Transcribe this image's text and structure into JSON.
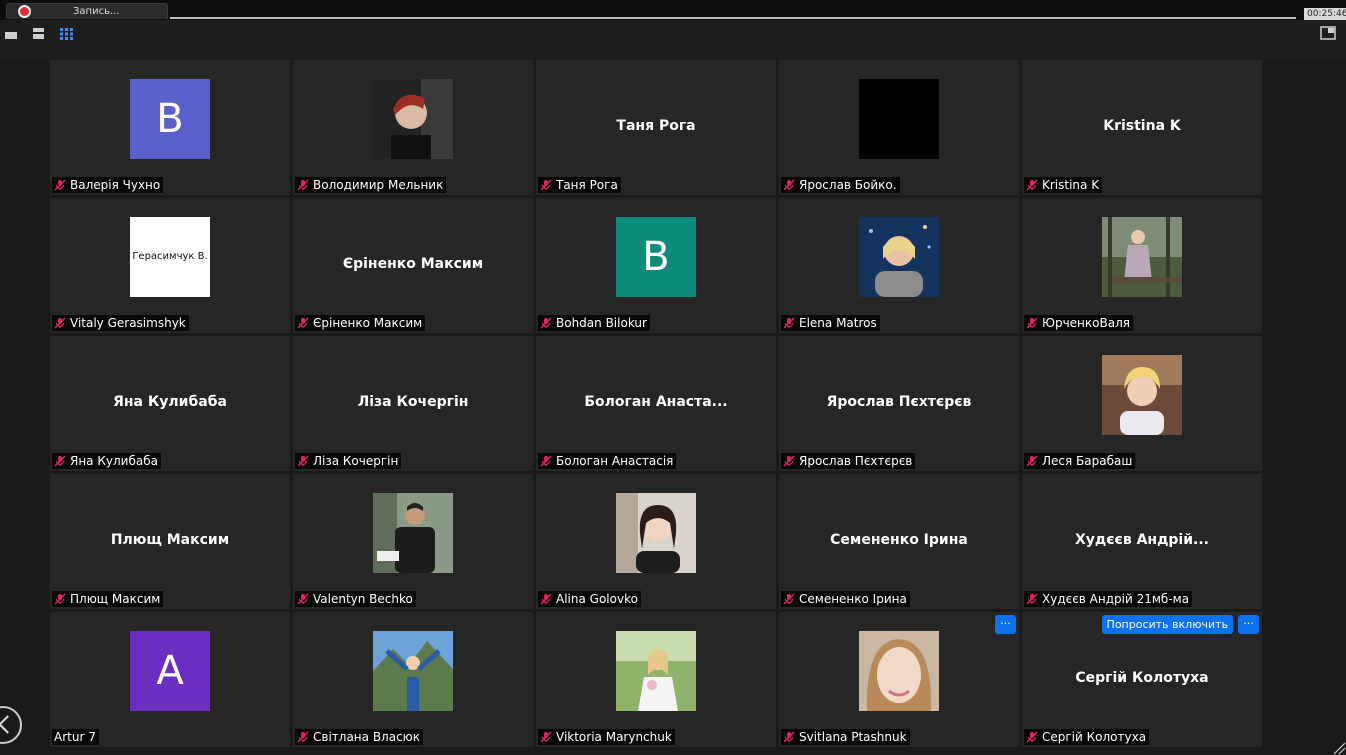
{
  "app": {
    "recording_label": "Запись...",
    "timer": "00:25:46",
    "accent_color": "#0e72ed"
  },
  "participants": [
    {
      "display_name": "Валерія Чухно",
      "avatar_letter": "B",
      "avatar_color": "#5a5fc9"
    },
    {
      "display_name": "Володимир Мельник",
      "photo": "photo-portrait-dark"
    },
    {
      "display_name": "Таня Рога",
      "center_name": "Таня Рога"
    },
    {
      "display_name": "Ярослав Бойко.",
      "photo": "black-video"
    },
    {
      "display_name": "Kristina K",
      "center_name": "Kristina K"
    },
    {
      "display_name": "Vitaly Gerasimshyk",
      "card_text": "Герасимчук В."
    },
    {
      "display_name": "Єріненко Максим",
      "center_name": "Єріненко Максим"
    },
    {
      "display_name": "Bohdan Bilokur",
      "avatar_letter": "B",
      "avatar_color": "#0c8a7a"
    },
    {
      "display_name": "Elena Matros",
      "photo": "photo-portrait-night"
    },
    {
      "display_name": "ЮрченкоВаля",
      "photo": "photo-portrait-forest"
    },
    {
      "display_name": "Яна Кулибаба",
      "center_name": "Яна Кулибаба"
    },
    {
      "display_name": "Ліза Кочергін",
      "center_name": "Ліза Кочергін"
    },
    {
      "display_name": "Бологан Анастасія",
      "center_name": "Бологан  Анаста..."
    },
    {
      "display_name": "Ярослав Пєхтєрєв",
      "center_name": "Ярослав Пєхтєрєв"
    },
    {
      "display_name": "Леся Барабаш",
      "photo": "photo-portrait-blonde"
    },
    {
      "display_name": "Плющ Максим",
      "center_name": "Плющ Максим"
    },
    {
      "display_name": "Valentyn Bechko",
      "photo": "photo-portrait-man"
    },
    {
      "display_name": "Alina Golovko",
      "photo": "photo-portrait-girl"
    },
    {
      "display_name": "Семененко Ірина",
      "center_name": "Семененко Ірина"
    },
    {
      "display_name": "Худєєв Андрій 21мб-ма",
      "center_name": "Худєєв Андрій..."
    },
    {
      "display_name": "Artur 7",
      "avatar_letter": "A",
      "avatar_color": "#6a2fc0",
      "unmuted": true
    },
    {
      "display_name": "Світлана Власюк",
      "photo": "photo-mountains"
    },
    {
      "display_name": "Viktoria Marynchuk",
      "photo": "photo-garden"
    },
    {
      "display_name": "Svitlana Ptashnuk",
      "photo": "photo-closeup",
      "more_button": "···"
    },
    {
      "display_name": "Сергій Колотуха",
      "center_name": "Сергій Колотуха",
      "ask_button": "Попросить включить",
      "more_button": "···"
    }
  ]
}
